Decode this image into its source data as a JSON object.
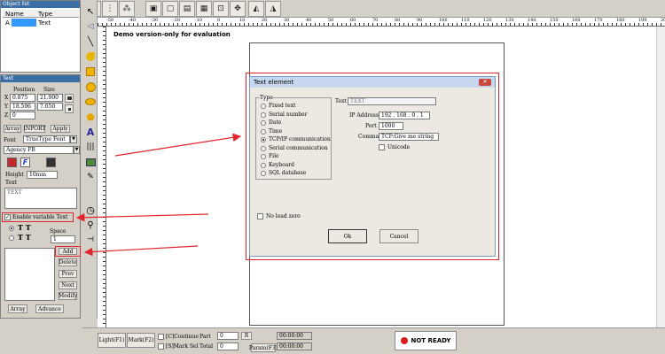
{
  "object_list": {
    "title": "Object list",
    "col_name": "Name",
    "col_type": "Type",
    "rows": [
      {
        "name": "A",
        "type": "Text"
      }
    ]
  },
  "text_panel": {
    "title": "Text",
    "position_label": "Position",
    "size_label": "Size",
    "x_label": "X",
    "y_label": "Y",
    "z_label": "Z",
    "x_pos": "0.875",
    "y_pos": "18.596",
    "z_pos": "0",
    "x_size": "21.900",
    "y_size": "7.650",
    "array_label": "Array",
    "import_label": "INPORT",
    "apply_label": "Apply",
    "font_label": "Font",
    "font_value": "TrueType Font",
    "font_name": "Agency FB",
    "height_label": "Height",
    "height_value": "10mm",
    "text_label": "Text",
    "text_value": "TEXT",
    "enable_variable_text": "Enable variable Text",
    "space_label": "Space",
    "space_value": "1",
    "add_label": "Add",
    "delete_label": "Delete",
    "prev_label": "Prev",
    "next_label": "Next",
    "modify_label": "Modify",
    "array2_label": "Array",
    "advance_label": "Advance"
  },
  "canvas": {
    "watermark": "Demo version-only for evaluation",
    "ruler_top": [
      "-50",
      "-40",
      "-30",
      "-20",
      "-10",
      "0",
      "10",
      "20",
      "30",
      "40",
      "50",
      "60",
      "70",
      "80",
      "90",
      "100",
      "110",
      "120",
      "130",
      "140",
      "150",
      "160",
      "170",
      "180",
      "190",
      "200"
    ]
  },
  "dialog": {
    "title": "Text element",
    "type_group": "Type",
    "types": [
      "Fixed text",
      "Serial number",
      "Date",
      "Time",
      "TCP/IP communication",
      "Serial communication",
      "File",
      "Keyboard",
      "SQL database"
    ],
    "selected_type": "TCP/IP communication",
    "text_label": "Text",
    "text_value": "TEXT",
    "ip_label": "IP Address",
    "ip_value": "192 . 168 .  0  .  1",
    "port_label": "Port",
    "port_value": "1000",
    "command_label": "Command",
    "command_value": "TCP:Give me string",
    "unicode_label": "Unicode",
    "no_lead_zero": "No lead zero",
    "ok_label": "Ok",
    "cancel_label": "Cancel"
  },
  "bottom": {
    "light_label": "Light(F1)",
    "mark_label": "Mark(F2)",
    "continue_label": "[C]Continue",
    "mark_sel_label": "[S]Mark Sel",
    "part_label": "Part",
    "part_value": "0",
    "total_label": "Total",
    "total_value": "0",
    "r_label": "R",
    "time1": "00:00:00",
    "time2": "00:00:00",
    "param_label": "Param(F3)",
    "status": "NOT READY"
  },
  "colors": {
    "panel_title": "#3a6ea5",
    "highlight_red": "#e0262c",
    "dialog_title": "#c7d7ef"
  }
}
